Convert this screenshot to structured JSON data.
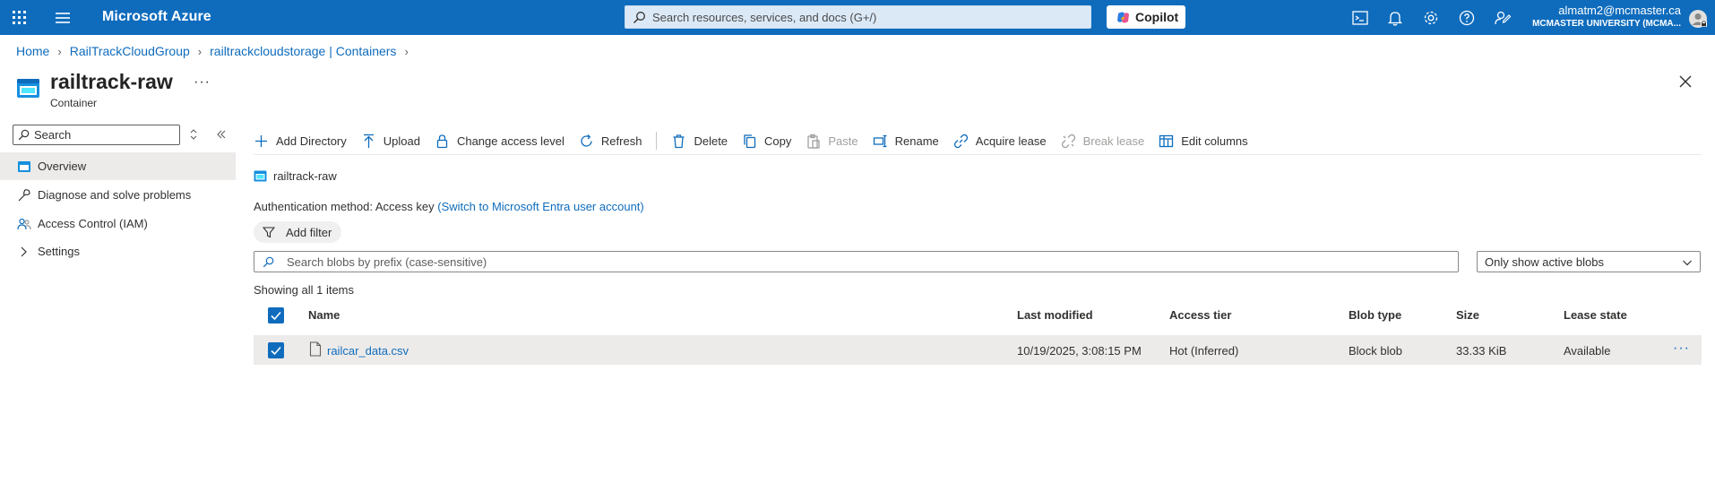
{
  "topbar": {
    "brand": "Microsoft Azure",
    "search_placeholder": "Search resources, services, and docs (G+/)",
    "copilot_label": "Copilot",
    "account_email": "almatm2@mcmaster.ca",
    "account_org": "MCMASTER UNIVERSITY (MCMA...",
    "icons": [
      "cloud-shell-icon",
      "notifications-icon",
      "settings-icon",
      "help-icon",
      "feedback-icon"
    ],
    "accent_color": "#0f6cbd"
  },
  "breadcrumb": [
    "Home",
    "RailTrackCloudGroup",
    "railtrackcloudstorage | Containers"
  ],
  "page": {
    "title": "railtrack-raw",
    "subtitle": "Container",
    "more": "···"
  },
  "sidebar": {
    "search_placeholder": "Search",
    "items": [
      {
        "label": "Overview",
        "icon": "overview-icon",
        "selected": true
      },
      {
        "label": "Diagnose and solve problems",
        "icon": "wrench-icon",
        "selected": false
      },
      {
        "label": "Access Control (IAM)",
        "icon": "people-icon",
        "selected": false
      },
      {
        "label": "Settings",
        "icon": "chevron-right-icon",
        "selected": false
      }
    ]
  },
  "toolbar": {
    "add_directory": "Add Directory",
    "upload": "Upload",
    "change_access_level": "Change access level",
    "refresh": "Refresh",
    "delete": "Delete",
    "copy": "Copy",
    "paste": "Paste",
    "rename": "Rename",
    "acquire_lease": "Acquire lease",
    "break_lease": "Break lease",
    "edit_columns": "Edit columns"
  },
  "content": {
    "path": "railtrack-raw",
    "auth_label": "Authentication method:",
    "auth_value": "Access key",
    "auth_link": "(Switch to Microsoft Entra user account)",
    "add_filter": "Add filter",
    "blob_search_placeholder": "Search blobs by prefix (case-sensitive)",
    "blob_filter_selected": "Only show active blobs",
    "count_text": "Showing all 1 items"
  },
  "table": {
    "columns": [
      "Name",
      "Last modified",
      "Access tier",
      "Blob type",
      "Size",
      "Lease state"
    ],
    "rows": [
      {
        "name": "railcar_data.csv",
        "last_modified": "10/19/2025, 3:08:15 PM",
        "access_tier": "Hot (Inferred)",
        "blob_type": "Block blob",
        "size": "33.33 KiB",
        "lease_state": "Available",
        "selected": true,
        "more": "···"
      }
    ]
  }
}
